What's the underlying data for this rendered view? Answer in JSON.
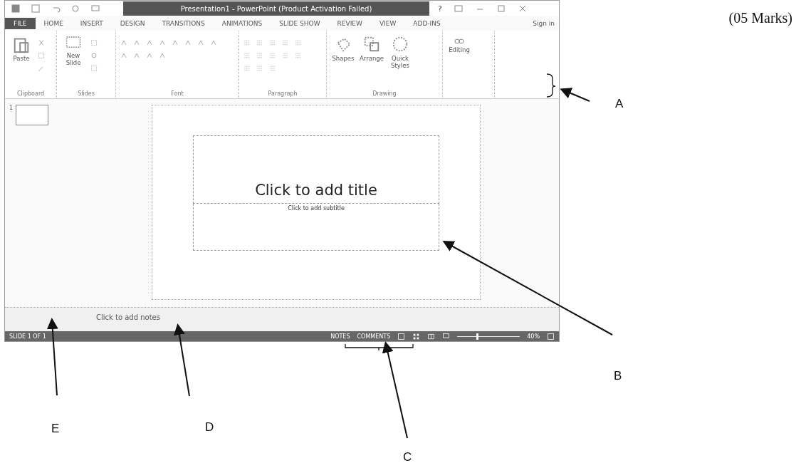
{
  "marks": "(05 Marks)",
  "window": {
    "title": "Presentation1 - PowerPoint (Product Activation Failed)",
    "help": "?"
  },
  "tabs": [
    {
      "label": "FILE",
      "kind": "file"
    },
    {
      "label": "HOME",
      "kind": "tab"
    },
    {
      "label": "INSERT",
      "kind": "tab"
    },
    {
      "label": "DESIGN",
      "kind": "tab"
    },
    {
      "label": "TRANSITIONS",
      "kind": "tab"
    },
    {
      "label": "ANIMATIONS",
      "kind": "tab"
    },
    {
      "label": "SLIDE SHOW",
      "kind": "tab"
    },
    {
      "label": "REVIEW",
      "kind": "tab"
    },
    {
      "label": "VIEW",
      "kind": "tab"
    },
    {
      "label": "ADD-INS",
      "kind": "tab"
    }
  ],
  "sign_in": "Sign in",
  "ribbon": {
    "groups": [
      {
        "name": "Clipboard",
        "kind": "clipboard",
        "buttons": [
          "Paste"
        ]
      },
      {
        "name": "Slides",
        "kind": "slides",
        "buttons": [
          "New Slide"
        ]
      },
      {
        "name": "Font",
        "kind": "font"
      },
      {
        "name": "Paragraph",
        "kind": "paragraph"
      },
      {
        "name": "Drawing",
        "kind": "drawing",
        "buttons": [
          "Shapes",
          "Arrange",
          "Quick Styles"
        ]
      },
      {
        "kind": "editing",
        "buttons": [
          "Editing"
        ]
      }
    ]
  },
  "thumbnails": [
    "1"
  ],
  "slide": {
    "title": "Click to add title",
    "subtitle": "Click to add subtitle"
  },
  "notes": {
    "placeholder": "Click to add notes"
  },
  "status_bar": {
    "slide": "SLIDE 1 OF 1",
    "notes": "NOTES",
    "comments": "COMMENTS",
    "zoom": {
      "level": 0.3
    },
    "zoom_reading": "40%"
  },
  "labels": [
    {
      "letter": "A",
      "kind": "a"
    },
    {
      "letter": "B",
      "kind": "b"
    },
    {
      "letter": "C",
      "kind": "c"
    },
    {
      "letter": "D",
      "kind": "d"
    },
    {
      "letter": "E",
      "kind": "e"
    }
  ]
}
